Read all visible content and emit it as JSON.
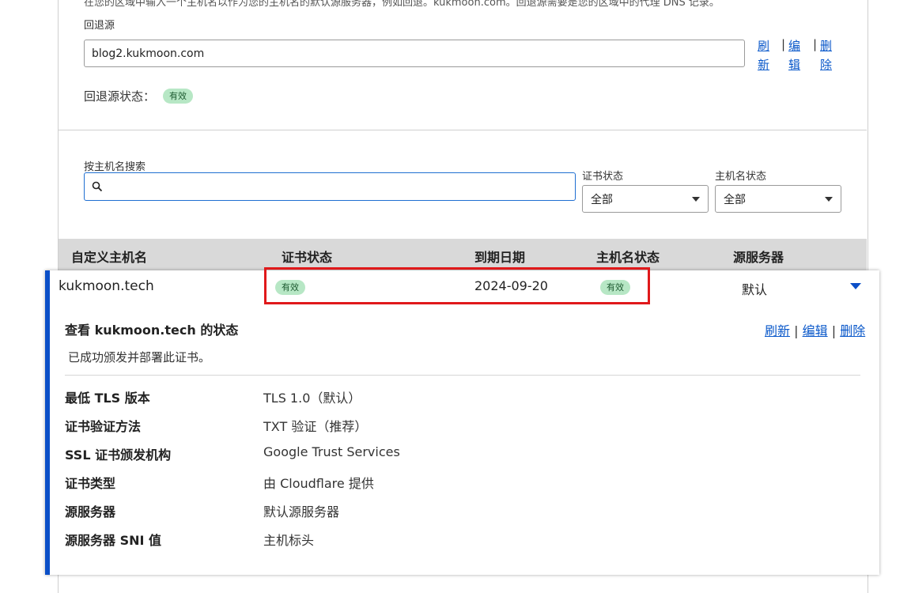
{
  "top_section": {
    "cut_off_text": "在您的区域中输入一个主机名以作为您的主机名的默认源服务器，例如回退。kukmoon.com。回退源需要是您的区域中的代理 DNS 记录。",
    "fallback_label": "回退源",
    "fallback_value": "blog2.kukmoon.com",
    "actions": [
      "刷新",
      "编辑",
      "删除"
    ],
    "status_label": "回退源状态：",
    "status_badge": "有效"
  },
  "filters": {
    "search_label": "按主机名搜索",
    "search_placeholder": "",
    "cert_status_label": "证书状态",
    "cert_status_value": "全部",
    "hostname_status_label": "主机名状态",
    "hostname_status_value": "全部"
  },
  "table": {
    "headers": [
      "自定义主机名",
      "证书状态",
      "到期日期",
      "主机名状态",
      "源服务器"
    ],
    "row": {
      "hostname": "kukmoon.tech",
      "cert_status": "有效",
      "expiry": "2024-09-20",
      "hostname_status": "有效",
      "origin": "默认"
    }
  },
  "detail": {
    "title": "查看 kukmoon.tech 的状态",
    "actions": [
      "刷新",
      "编辑",
      "删除"
    ],
    "message": "已成功颁发并部署此证书。",
    "fields": [
      {
        "label": "最低 TLS 版本",
        "value": "TLS 1.0（默认）"
      },
      {
        "label": "证书验证方法",
        "value": "TXT 验证（推荐）"
      },
      {
        "label": "SSL 证书颁发机构",
        "value": "Google Trust Services"
      },
      {
        "label": "证书类型",
        "value": "由 Cloudflare 提供"
      },
      {
        "label": "源服务器",
        "value": "默认源服务器"
      },
      {
        "label": "源服务器 SNI 值",
        "value": "主机标头"
      }
    ]
  },
  "colors": {
    "link": "#0a58ca",
    "badge_bg": "#b7e7c5",
    "accent_bar": "#0b4fc7",
    "highlight_box": "#e0191b",
    "header_bg": "#d9d9d9"
  }
}
